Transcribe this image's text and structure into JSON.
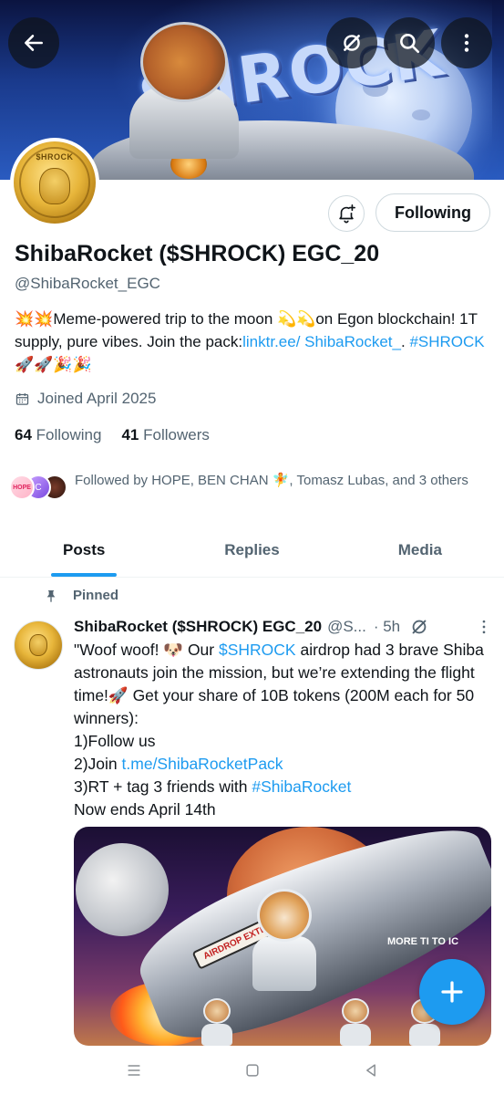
{
  "banner": {
    "title_text": "$HROCK"
  },
  "header_actions": {
    "back": "back-arrow-icon",
    "grok": "grok-icon",
    "search": "search-icon",
    "more": "more-vertical-icon"
  },
  "profile": {
    "avatar_text": "$HROCK",
    "following_button": "Following",
    "display_name": "ShibaRocket ($SHROCK) EGC_20",
    "handle": "@ShibaRocket_EGC",
    "bio": {
      "part1": "💥💥Meme-powered trip to the moon 💫💫on Egon blockchain! 1T supply, pure vibes. Join the pack:",
      "link": "linktr.ee/ ShibaRocket_",
      "part2": ". ",
      "hashtag": "#SHROCK",
      "part3": "🚀🚀🎉🎉"
    },
    "joined": "Joined April 2025",
    "following_count": "64",
    "following_label": "Following",
    "followers_count": "41",
    "followers_label": "Followers",
    "followed_by": "Followed by HOPE, BEN CHAN 🧚, Tomasz Lubas, and 3 others",
    "followed_avatars": [
      "HOPE",
      "C",
      ""
    ]
  },
  "tabs": [
    {
      "label": "Posts",
      "active": true
    },
    {
      "label": "Replies",
      "active": false
    },
    {
      "label": "Media",
      "active": false
    }
  ],
  "post": {
    "pinned_label": "Pinned",
    "author_name": "ShibaRocket ($SHROCK) EGC_20",
    "author_handle": "@S...",
    "time": "· 5h",
    "text_1": "\"Woof woof! 🐶 Our ",
    "cashtag": "$SHROCK",
    "text_2": " airdrop had 3 brave Shiba astronauts join the mission, but we’re extending the flight time!🚀 Get your share of 10B tokens (200M each for 50 winners):",
    "line_1": "1)Follow us",
    "line_2_prefix": "2)Join ",
    "line_2_link": "t.me/ShibaRocketPack",
    "line_3_prefix": "3)RT + tag 3 friends with ",
    "line_3_hashtag": "#ShibaRocket",
    "line_4": "Now ends April 14th",
    "image": {
      "tag_text": "AIRDROP EXTENDED!",
      "more_text": "MORE TI TO IC"
    }
  },
  "fab": {
    "icon": "plus-icon"
  },
  "system_nav": [
    "recents-icon",
    "home-icon",
    "back-triangle-icon"
  ],
  "colors": {
    "accent": "#1d9bf0",
    "text_primary": "#0f1419",
    "text_secondary": "#536471"
  }
}
